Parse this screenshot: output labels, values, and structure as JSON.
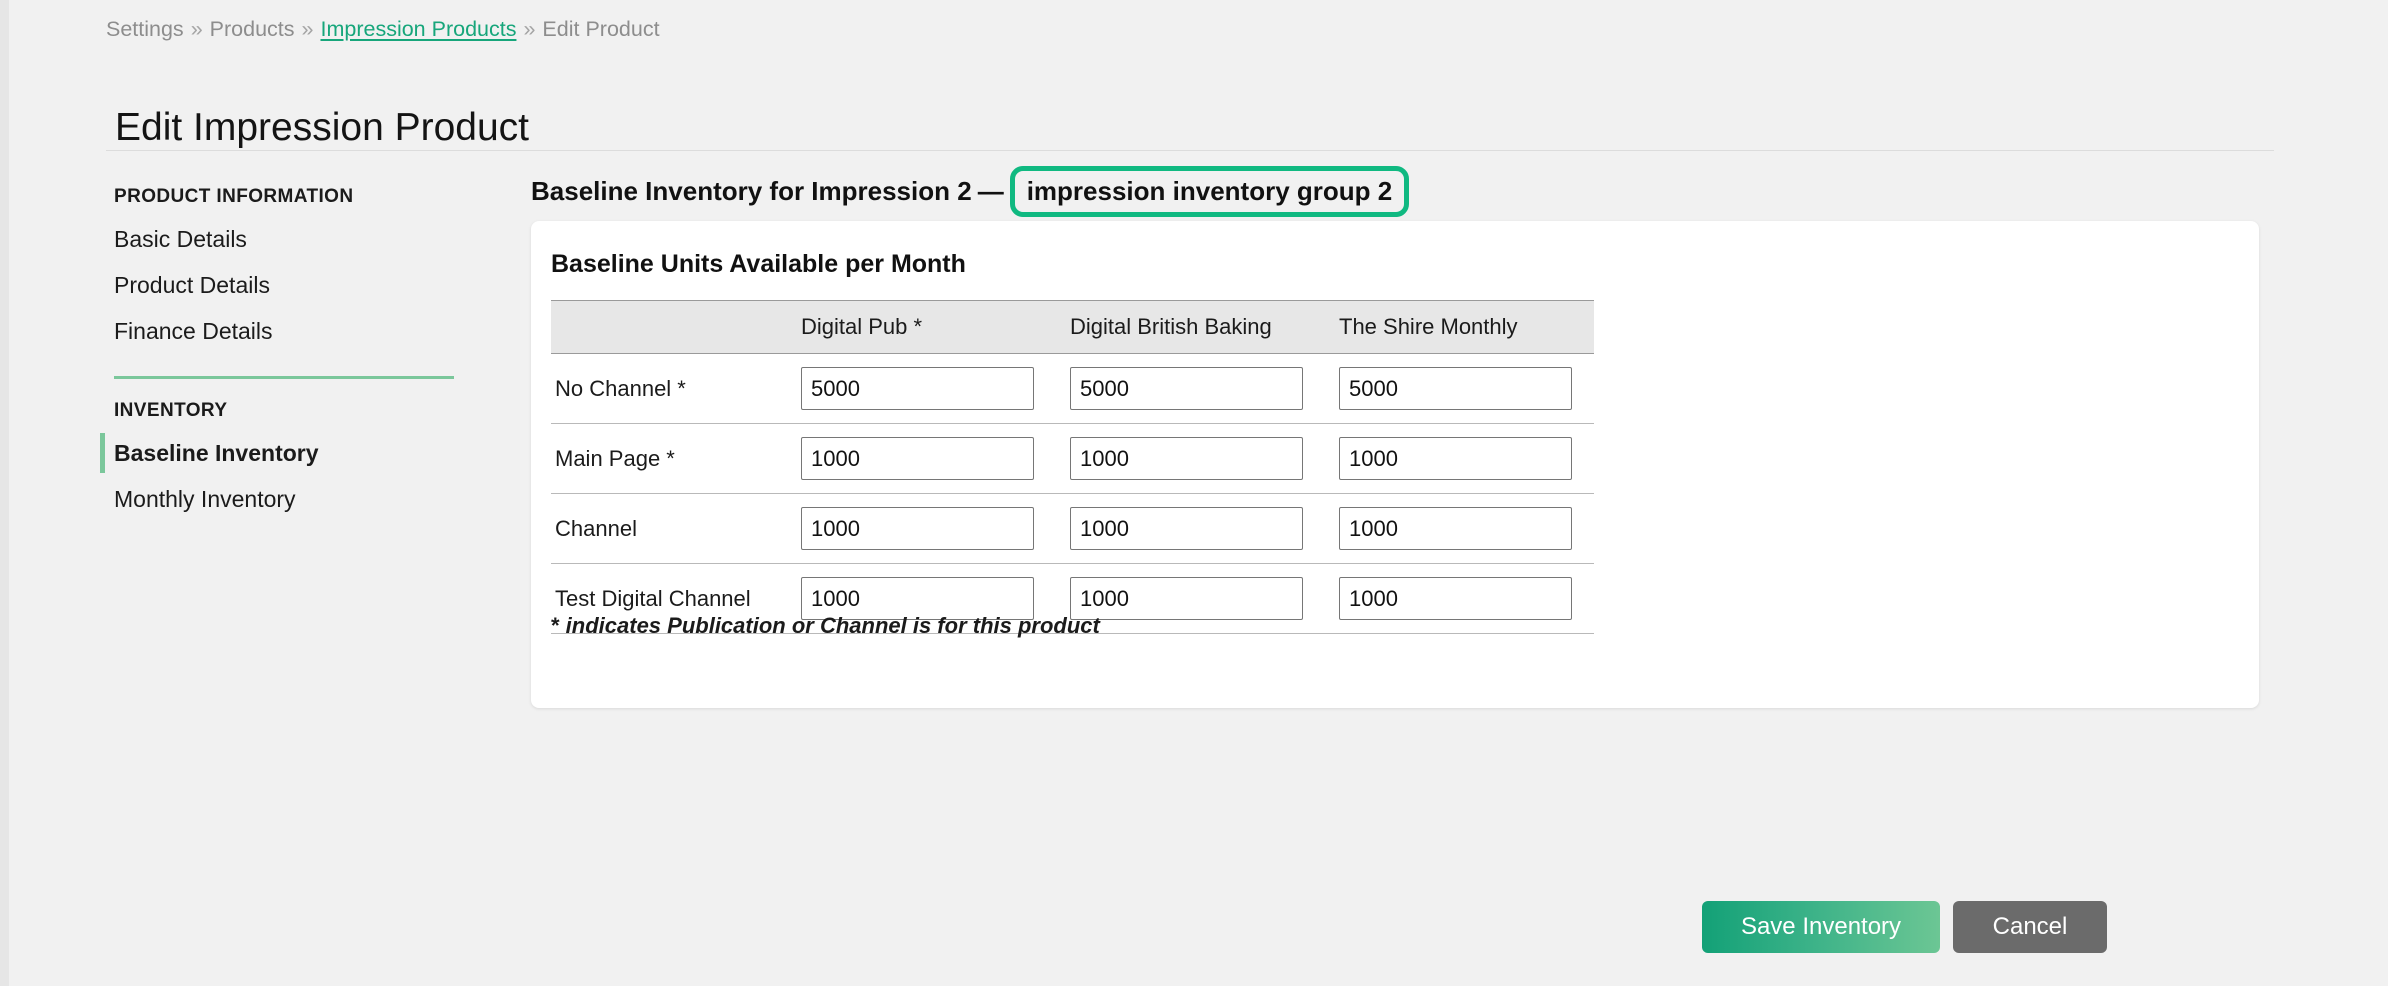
{
  "breadcrumb": {
    "separator": "»",
    "items": [
      {
        "label": "Settings",
        "is_link": false
      },
      {
        "label": "Products",
        "is_link": false
      },
      {
        "label": "Impression Products",
        "is_link": true
      },
      {
        "label": "Edit Product",
        "is_link": false
      }
    ]
  },
  "page_title": "Edit Impression Product",
  "sidebar": {
    "groups": [
      {
        "label": "PRODUCT INFORMATION",
        "items": [
          {
            "label": "Basic Details",
            "active": false
          },
          {
            "label": "Product Details",
            "active": false
          },
          {
            "label": "Finance Details",
            "active": false
          }
        ]
      },
      {
        "label": "INVENTORY",
        "items": [
          {
            "label": "Baseline Inventory",
            "active": true
          },
          {
            "label": "Monthly Inventory",
            "active": false
          }
        ]
      }
    ]
  },
  "panel": {
    "heading_prefix": "Baseline Inventory for Impression 2",
    "heading_dash": "—",
    "group_badge": "impression inventory group 2",
    "card_title": "Baseline Units Available per Month",
    "footnote_star": "*",
    "footnote_text": " indicates Publication or Channel is for this product"
  },
  "table": {
    "row_header_label": "",
    "columns": [
      "Digital Pub *",
      "Digital British Baking",
      "The Shire Monthly"
    ],
    "rows": [
      {
        "label": "No Channel *",
        "values": [
          "5000",
          "5000",
          "5000"
        ]
      },
      {
        "label": "Main Page *",
        "values": [
          "1000",
          "1000",
          "1000"
        ]
      },
      {
        "label": "Channel",
        "values": [
          "1000",
          "1000",
          "1000"
        ]
      },
      {
        "label": "Test Digital Channel",
        "values": [
          "1000",
          "1000",
          "1000"
        ]
      }
    ]
  },
  "actions": {
    "save_label": "Save Inventory",
    "cancel_label": "Cancel"
  },
  "colors": {
    "accent_green": "#10b981",
    "link_green": "#17a67b",
    "sidebar_accent": "#7bc79b",
    "save_gradient_start": "#13a177",
    "save_gradient_end": "#6cc694",
    "cancel_gray": "#6b6b6b",
    "page_background": "#f1f1f1",
    "card_background": "#ffffff",
    "table_header_background": "#e7e7e7"
  }
}
